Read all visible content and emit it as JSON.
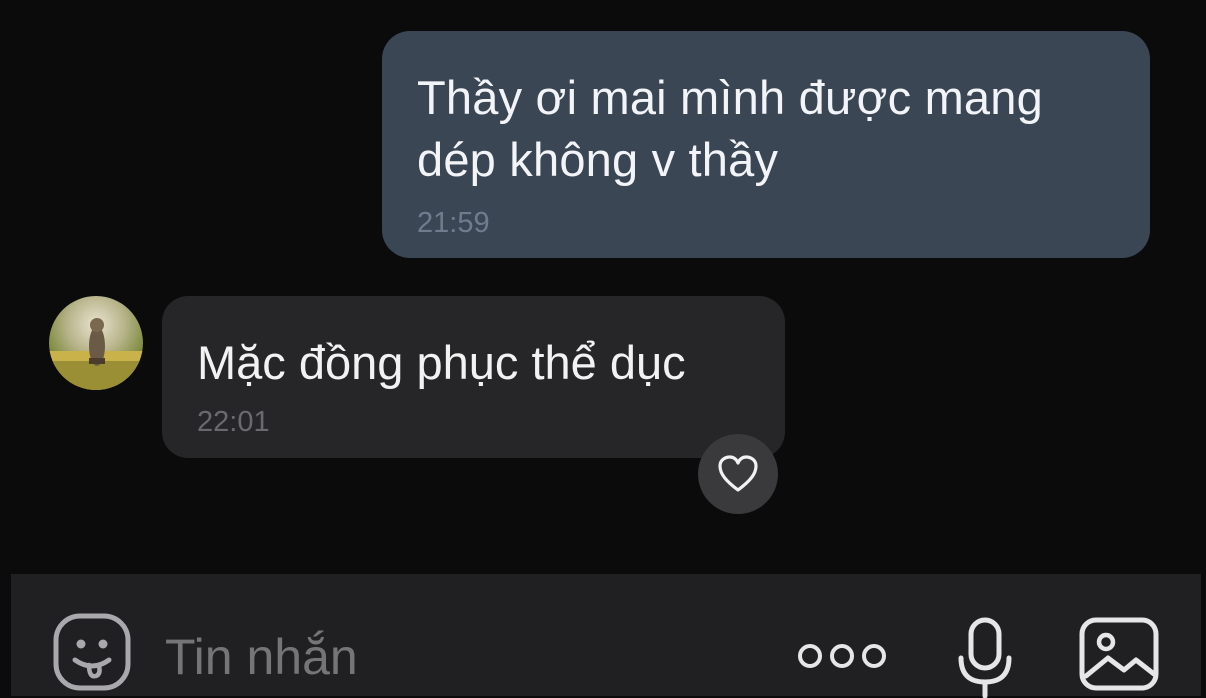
{
  "messages": [
    {
      "direction": "outgoing",
      "text": "Thầy ơi mai mình được mang dép không v thầy",
      "time": "21:59"
    },
    {
      "direction": "incoming",
      "text": "Mặc đồng phục thể dục",
      "time": "22:01",
      "reaction": "heart-icon"
    }
  ],
  "composer": {
    "placeholder": "Tin nhắn",
    "icons": [
      "emoji-icon",
      "more-icon",
      "mic-icon",
      "image-icon"
    ]
  },
  "colors": {
    "background": "#0b0b0c",
    "outgoing_bubble": "#3b4655",
    "incoming_bubble": "#262628",
    "composer": "#202022"
  }
}
